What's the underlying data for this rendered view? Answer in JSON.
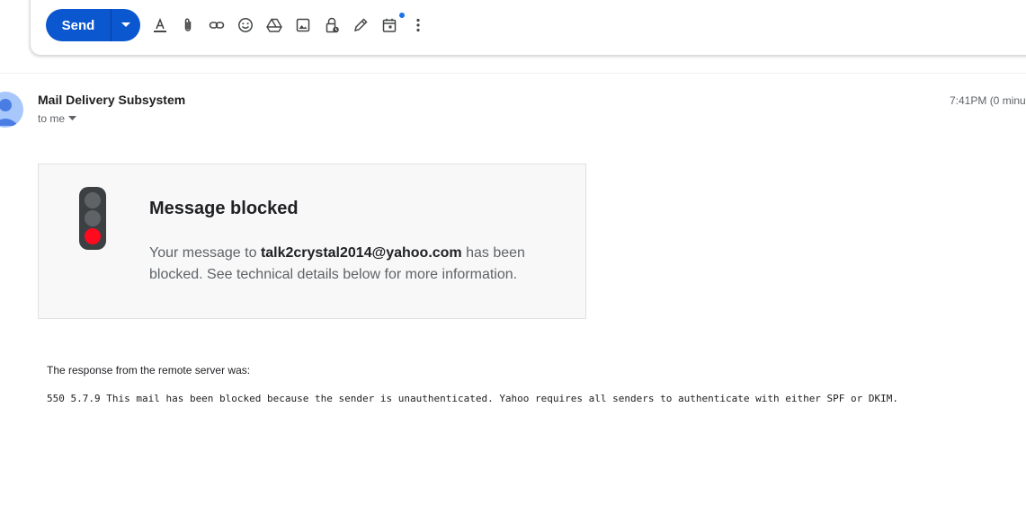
{
  "toolbar": {
    "send_label": "Send",
    "icons": [
      "text-format-icon",
      "attach-icon",
      "link-icon",
      "emoji-icon",
      "drive-icon",
      "photo-icon",
      "confidential-lock-icon",
      "signature-pen-icon",
      "schedule-calendar-icon",
      "more-vert-icon"
    ]
  },
  "message": {
    "sender": "Mail Delivery Subsystem",
    "recipient_label": "to me",
    "time": "7:41PM (0 minu"
  },
  "blocked": {
    "title": "Message blocked",
    "text_before": "Your message to ",
    "address": "talk2crystal2014@yahoo.com",
    "text_after": " has been blocked. See technical details below for more information."
  },
  "response": {
    "label": "The response from the remote server was:",
    "code": "550 5.7.9 This mail has been blocked because the sender is unauthenticated. Yahoo requires all senders to authenticate with either SPF or DKIM."
  },
  "colors": {
    "accent": "#0b57d0",
    "light_red": "#ff0a1e",
    "notification_dot": "#1a73e8"
  }
}
